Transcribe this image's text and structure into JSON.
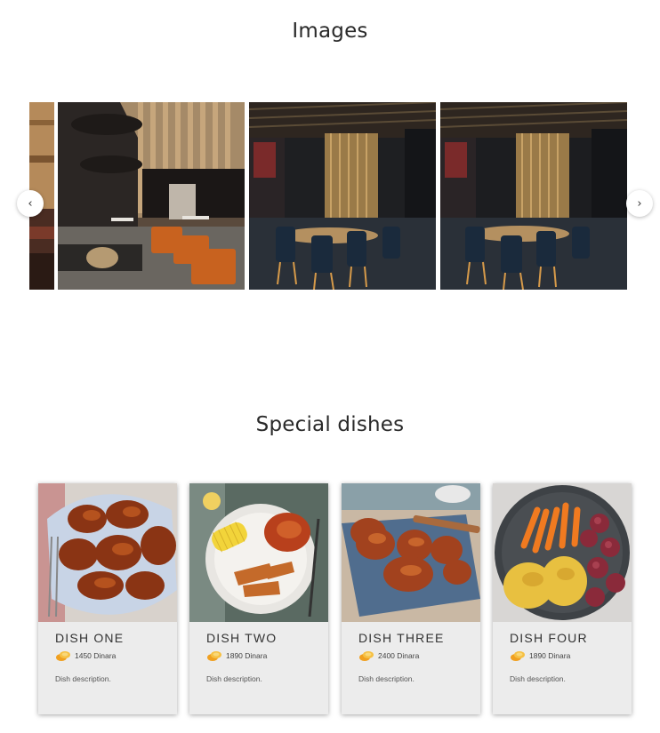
{
  "gallery": {
    "title": "Images",
    "prev_label": "‹",
    "next_label": "›"
  },
  "dishes": {
    "title": "Special dishes",
    "items": [
      {
        "name": "DISH ONE",
        "price": "1450 Dinara",
        "description": "Dish description."
      },
      {
        "name": "DISH TWO",
        "price": "1890 Dinara",
        "description": "Dish description."
      },
      {
        "name": "DISH THREE",
        "price": "2400 Dinara",
        "description": "Dish description."
      },
      {
        "name": "DISH FOUR",
        "price": "1890 Dinara",
        "description": "Dish description."
      }
    ]
  }
}
